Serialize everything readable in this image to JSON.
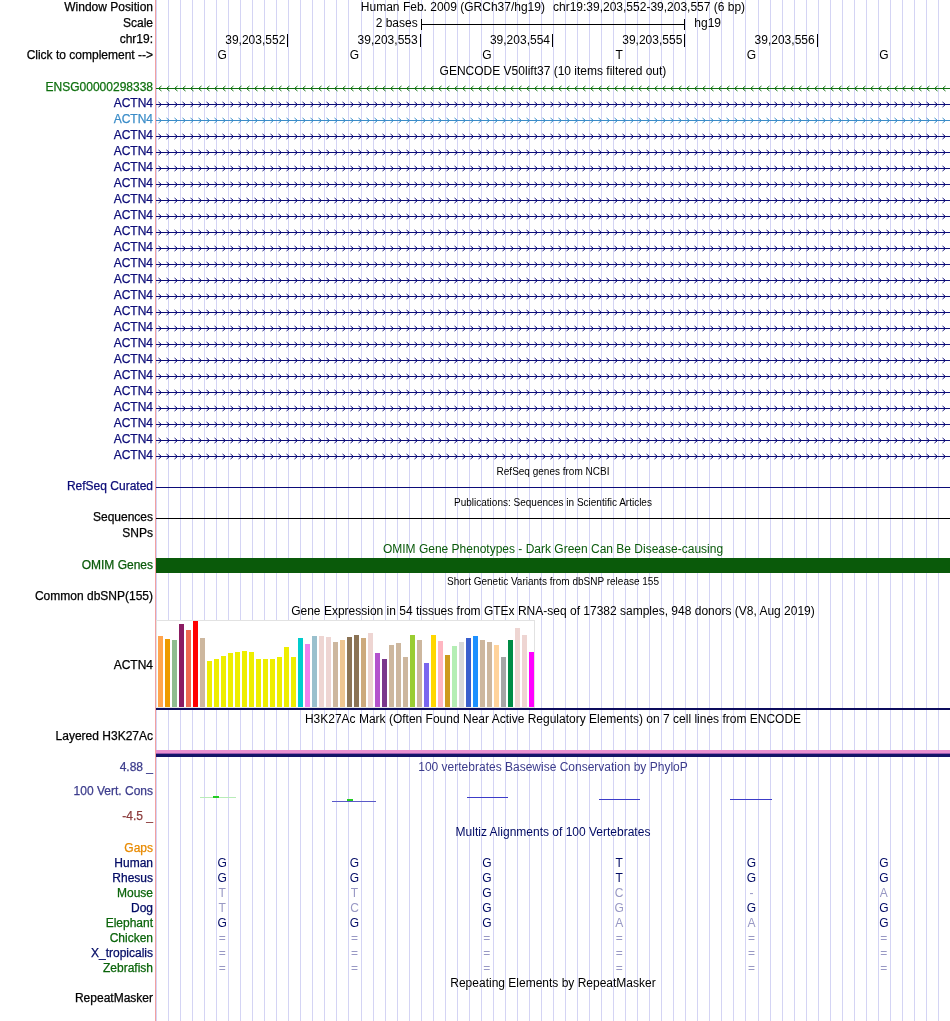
{
  "ruler": {
    "window_position": {
      "label": "Window Position",
      "assembly": "Human Feb. 2009 (GRCh37/hg19)",
      "position": "chr19:39,203,552-39,203,557 (6 bp)"
    },
    "scale": {
      "label": "Scale",
      "span": "2 bases",
      "assembly": "hg19"
    },
    "coordinates": {
      "label": "chr19:",
      "positions": [
        "39,203,552",
        "39,203,553",
        "39,203,554",
        "39,203,555",
        "39,203,556"
      ]
    },
    "sequence": {
      "label": "Click to complement -->",
      "bases": [
        "G",
        "G",
        "G",
        "T",
        "G",
        "G"
      ]
    }
  },
  "tracks": [
    {
      "kind": "genes",
      "title": "GENCODE V50lift37 (10 items filtered out)",
      "rows": [
        {
          "label": "ENSG00000298338",
          "color": "#0f700f",
          "reverse": true
        },
        {
          "label": "ACTN4",
          "color": "#0c0c78",
          "reverse": false
        },
        {
          "label": "ACTN4",
          "color": "#3a8cc8",
          "reverse": false
        },
        {
          "label": "ACTN4",
          "color": "#0c0c78",
          "reverse": false
        },
        {
          "label": "ACTN4",
          "color": "#0c0c78",
          "reverse": false
        },
        {
          "label": "ACTN4",
          "color": "#0c0c78",
          "reverse": false
        },
        {
          "label": "ACTN4",
          "color": "#0c0c78",
          "reverse": false
        },
        {
          "label": "ACTN4",
          "color": "#0c0c78",
          "reverse": false
        },
        {
          "label": "ACTN4",
          "color": "#0c0c78",
          "reverse": false
        },
        {
          "label": "ACTN4",
          "color": "#0c0c78",
          "reverse": false
        },
        {
          "label": "ACTN4",
          "color": "#0c0c78",
          "reverse": false
        },
        {
          "label": "ACTN4",
          "color": "#0c0c78",
          "reverse": false
        },
        {
          "label": "ACTN4",
          "color": "#0c0c78",
          "reverse": false
        },
        {
          "label": "ACTN4",
          "color": "#0c0c78",
          "reverse": false
        },
        {
          "label": "ACTN4",
          "color": "#0c0c78",
          "reverse": false
        },
        {
          "label": "ACTN4",
          "color": "#0c0c78",
          "reverse": false
        },
        {
          "label": "ACTN4",
          "color": "#0c0c78",
          "reverse": false
        },
        {
          "label": "ACTN4",
          "color": "#0c0c78",
          "reverse": false
        },
        {
          "label": "ACTN4",
          "color": "#0c0c78",
          "reverse": false
        },
        {
          "label": "ACTN4",
          "color": "#0c0c78",
          "reverse": false
        },
        {
          "label": "ACTN4",
          "color": "#0c0c78",
          "reverse": false
        },
        {
          "label": "ACTN4",
          "color": "#0c0c78",
          "reverse": false
        },
        {
          "label": "ACTN4",
          "color": "#0c0c78",
          "reverse": false
        },
        {
          "label": "ACTN4",
          "color": "#0c0c78",
          "reverse": false
        }
      ]
    },
    {
      "kind": "lines",
      "title": "RefSeq genes from NCBI",
      "rows": [
        {
          "label": "RefSeq Curated",
          "color": "#0c0c78",
          "line": true
        }
      ]
    },
    {
      "kind": "lines",
      "title": "Publications: Sequences in Scientific Articles",
      "rows": [
        {
          "label": "Sequences",
          "color": "#000000",
          "line": true
        },
        {
          "label": "SNPs",
          "color": "#000000",
          "line": false
        }
      ]
    },
    {
      "kind": "bar",
      "title": "OMIM Gene Phenotypes - Dark Green Can Be Disease-causing",
      "color": "#0a5a0a",
      "rows": [
        {
          "label": "OMIM Genes",
          "color": "#0a5a0a"
        }
      ]
    },
    {
      "kind": "variants",
      "title": "Short Genetic Variants from dbSNP release 155",
      "rows": [
        {
          "label": "Common dbSNP(155)",
          "color": "#000000"
        }
      ]
    },
    {
      "kind": "expression",
      "title": "Gene Expression in 54 tissues from GTEx RNA-seq of 17382 samples, 948 donors (V8, Aug 2019)",
      "rows": [
        {
          "label": "ACTN4",
          "color": "#000000"
        }
      ]
    },
    {
      "kind": "signal",
      "title": "H3K27Ac Mark (Often Found Near Active Regulatory Elements) on 7 cell lines from ENCODE",
      "rows": [
        {
          "label": "Layered H3K27Ac",
          "color": "#000000"
        }
      ]
    },
    {
      "kind": "conservation",
      "title": "100 vertebrates Basewise Conservation by PhyloP",
      "color": "#3c3c8c",
      "scale": [
        {
          "text": "4.88 _",
          "color": "#3c3c8c"
        },
        {
          "text": "-4.5 _",
          "color": "#8c3c3c"
        }
      ],
      "rows": [
        {
          "label": "100 Vert. Cons",
          "color": "#3c3c8c"
        }
      ]
    },
    {
      "kind": "alignment",
      "title": "Multiz Alignments of 100 Vertebrates",
      "color": "#000a64",
      "rows": [
        {
          "label": "Gaps",
          "color": "#e88a00"
        },
        {
          "label": "Human",
          "color": "#000a64",
          "bases": [
            {
              "base": "G",
              "match": true
            },
            {
              "base": "G",
              "match": true
            },
            {
              "base": "G",
              "match": true
            },
            {
              "base": "T",
              "match": true
            },
            {
              "base": "G",
              "match": true
            },
            {
              "base": "G",
              "match": true
            }
          ]
        },
        {
          "label": "Rhesus",
          "color": "#000a64",
          "bases": [
            {
              "base": "G",
              "match": true
            },
            {
              "base": "G",
              "match": true
            },
            {
              "base": "G",
              "match": true
            },
            {
              "base": "T",
              "match": true
            },
            {
              "base": "G",
              "match": true
            },
            {
              "base": "G",
              "match": true
            }
          ]
        },
        {
          "label": "Mouse",
          "color": "#0a640a",
          "bases": [
            {
              "base": "T",
              "match": false
            },
            {
              "base": "T",
              "match": false
            },
            {
              "base": "G",
              "match": true
            },
            {
              "base": "C",
              "match": false
            },
            {
              "base": "-",
              "match": false
            },
            {
              "base": "A",
              "match": false
            }
          ]
        },
        {
          "label": "Dog",
          "color": "#000a64",
          "bases": [
            {
              "base": "T",
              "match": false
            },
            {
              "base": "C",
              "match": false
            },
            {
              "base": "G",
              "match": true
            },
            {
              "base": "G",
              "match": false
            },
            {
              "base": "G",
              "match": true
            },
            {
              "base": "G",
              "match": true
            }
          ]
        },
        {
          "label": "Elephant",
          "color": "#0a640a",
          "bases": [
            {
              "base": "G",
              "match": true
            },
            {
              "base": "G",
              "match": true
            },
            {
              "base": "G",
              "match": true
            },
            {
              "base": "A",
              "match": false
            },
            {
              "base": "A",
              "match": false
            },
            {
              "base": "G",
              "match": true
            }
          ]
        },
        {
          "label": "Chicken",
          "color": "#0a640a",
          "bases": [
            {
              "base": "=",
              "match": false
            },
            {
              "base": "=",
              "match": false
            },
            {
              "base": "=",
              "match": false
            },
            {
              "base": "=",
              "match": false
            },
            {
              "base": "=",
              "match": false
            },
            {
              "base": "=",
              "match": false
            }
          ]
        },
        {
          "label": "X_tropicalis",
          "color": "#000a64",
          "bases": [
            {
              "base": "=",
              "match": false
            },
            {
              "base": "=",
              "match": false
            },
            {
              "base": "=",
              "match": false
            },
            {
              "base": "=",
              "match": false
            },
            {
              "base": "=",
              "match": false
            },
            {
              "base": "=",
              "match": false
            }
          ]
        },
        {
          "label": "Zebrafish",
          "color": "#0a640a",
          "bases": [
            {
              "base": "=",
              "match": false
            },
            {
              "base": "=",
              "match": false
            },
            {
              "base": "=",
              "match": false
            },
            {
              "base": "=",
              "match": false
            },
            {
              "base": "=",
              "match": false
            },
            {
              "base": "=",
              "match": false
            }
          ]
        }
      ]
    },
    {
      "kind": "repeats",
      "title": "Repeating Elements by RepeatMasker",
      "rows": [
        {
          "label": "RepeatMasker",
          "color": "#000000"
        }
      ]
    }
  ]
}
